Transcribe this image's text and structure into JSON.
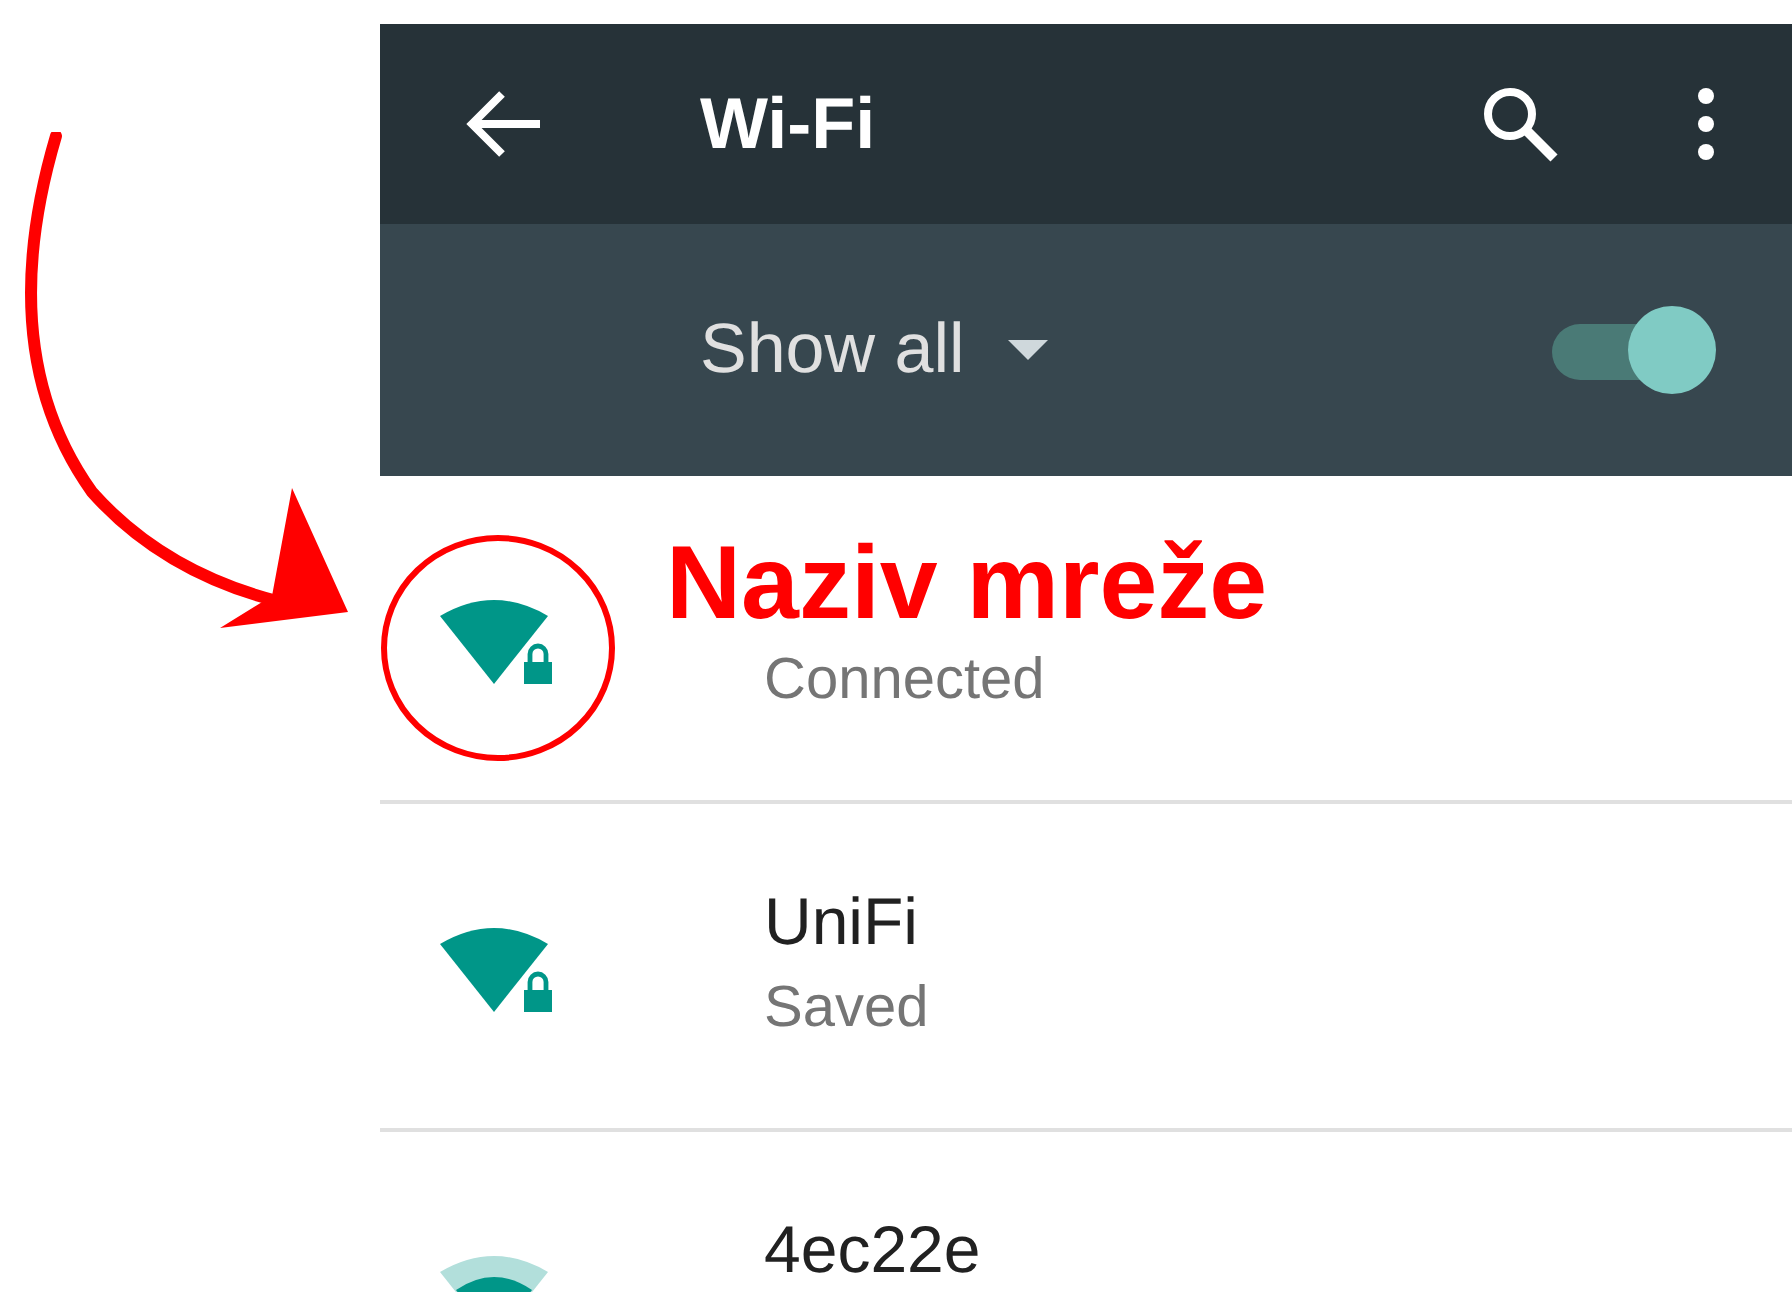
{
  "toolbar": {
    "title": "Wi-Fi"
  },
  "filter": {
    "label": "Show all",
    "on": true
  },
  "networks": [
    {
      "status": "Connected",
      "kind": "full"
    },
    {
      "name": "UniFi",
      "status": "Saved",
      "kind": "full"
    },
    {
      "name": "4ec22e",
      "kind": "medium"
    }
  ],
  "annotation": {
    "label": "Naziv mreže"
  }
}
